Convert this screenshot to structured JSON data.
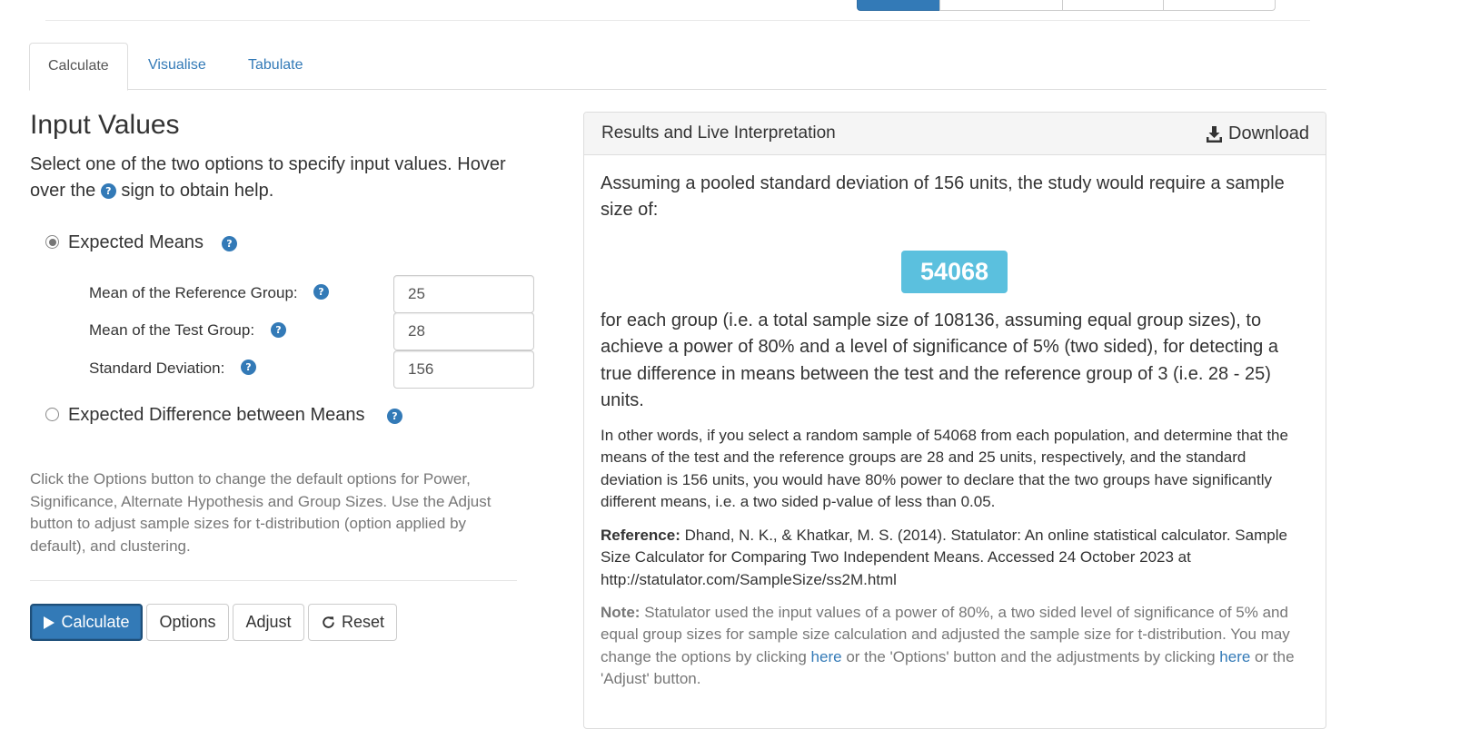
{
  "tabs": [
    "Calculate",
    "Visualise",
    "Tabulate"
  ],
  "input": {
    "heading": "Input Values",
    "lead_part1": "Select one of the two options to specify input values. Hover over the",
    "lead_part2": "sign to obtain help.",
    "help_glyph": "?",
    "option_means": "Expected Means",
    "option_difference": "Expected Difference between Means",
    "fields": [
      {
        "label": "Mean of the Reference Group:",
        "value": "25"
      },
      {
        "label": "Mean of the Test Group:",
        "value": "28"
      },
      {
        "label": "Standard Deviation:",
        "value": "156"
      }
    ],
    "helptext": "Click the Options button to change the default options for Power, Significance, Alternate Hypothesis and Group Sizes. Use the Adjust button to adjust sample sizes for t-distribution (option applied by default), and clustering."
  },
  "buttons": {
    "calculate": "Calculate",
    "options": "Options",
    "adjust": "Adjust",
    "reset": "Reset"
  },
  "results": {
    "title": "Results and Live Interpretation",
    "download": "Download",
    "intro": "Assuming a pooled standard deviation of 156 units, the study would require a sample size of:",
    "sample_size": "54068",
    "main": "for each group (i.e. a total sample size of 108136, assuming equal group sizes), to achieve a power of 80% and a level of significance of 5% (two sided), for detecting a true difference in means between the test and the reference group of 3 (i.e. 28 - 25) units.",
    "other_words": "In other words, if you select a random sample of 54068 from each population, and determine that the means of the test and the reference groups are 28 and 25 units, respectively, and the standard deviation is 156 units, you would have 80% power to declare that the two groups have significantly different means, i.e. a two sided p-value of less than 0.05.",
    "reference_label": "Reference:",
    "reference": "Dhand, N. K., & Khatkar, M. S. (2014). Statulator: An online statistical calculator. Sample Size Calculator for Comparing Two Independent Means. Accessed 24 October 2023 at http://statulator.com/SampleSize/ss2M.html",
    "note_label": "Note:",
    "note_part1": "Statulator used the input values of a power of 80%, a two sided level of significance of 5% and equal group sizes for sample size calculation and adjusted the sample size for t-distribution. You may change the options by clicking",
    "note_link1": "here",
    "note_part2": "or the 'Options' button and the adjustments by clicking",
    "note_link2": "here",
    "note_part3": "or the 'Adjust' button."
  },
  "colors": {
    "primary": "#337ab7",
    "info_badge": "#5bc0de",
    "muted_text": "#777777"
  }
}
